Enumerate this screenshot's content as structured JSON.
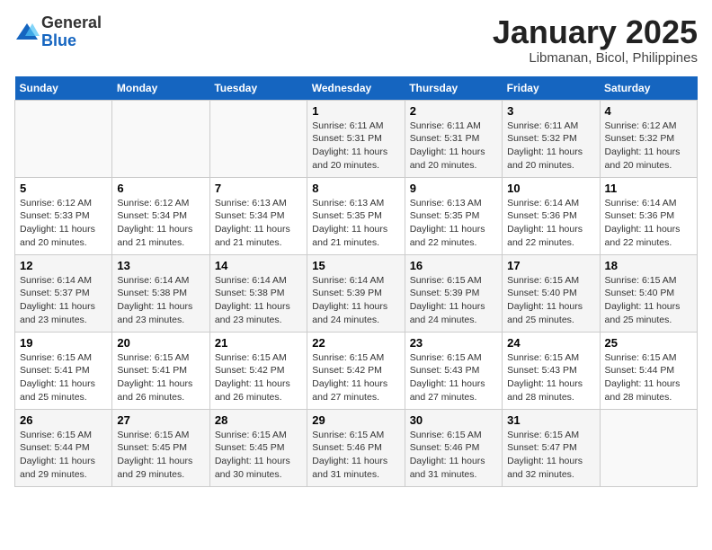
{
  "logo": {
    "general": "General",
    "blue": "Blue"
  },
  "header": {
    "month": "January 2025",
    "location": "Libmanan, Bicol, Philippines"
  },
  "days_of_week": [
    "Sunday",
    "Monday",
    "Tuesday",
    "Wednesday",
    "Thursday",
    "Friday",
    "Saturday"
  ],
  "weeks": [
    [
      {
        "day": "",
        "info": ""
      },
      {
        "day": "",
        "info": ""
      },
      {
        "day": "",
        "info": ""
      },
      {
        "day": "1",
        "info": "Sunrise: 6:11 AM\nSunset: 5:31 PM\nDaylight: 11 hours and 20 minutes."
      },
      {
        "day": "2",
        "info": "Sunrise: 6:11 AM\nSunset: 5:31 PM\nDaylight: 11 hours and 20 minutes."
      },
      {
        "day": "3",
        "info": "Sunrise: 6:11 AM\nSunset: 5:32 PM\nDaylight: 11 hours and 20 minutes."
      },
      {
        "day": "4",
        "info": "Sunrise: 6:12 AM\nSunset: 5:32 PM\nDaylight: 11 hours and 20 minutes."
      }
    ],
    [
      {
        "day": "5",
        "info": "Sunrise: 6:12 AM\nSunset: 5:33 PM\nDaylight: 11 hours and 20 minutes."
      },
      {
        "day": "6",
        "info": "Sunrise: 6:12 AM\nSunset: 5:34 PM\nDaylight: 11 hours and 21 minutes."
      },
      {
        "day": "7",
        "info": "Sunrise: 6:13 AM\nSunset: 5:34 PM\nDaylight: 11 hours and 21 minutes."
      },
      {
        "day": "8",
        "info": "Sunrise: 6:13 AM\nSunset: 5:35 PM\nDaylight: 11 hours and 21 minutes."
      },
      {
        "day": "9",
        "info": "Sunrise: 6:13 AM\nSunset: 5:35 PM\nDaylight: 11 hours and 22 minutes."
      },
      {
        "day": "10",
        "info": "Sunrise: 6:14 AM\nSunset: 5:36 PM\nDaylight: 11 hours and 22 minutes."
      },
      {
        "day": "11",
        "info": "Sunrise: 6:14 AM\nSunset: 5:36 PM\nDaylight: 11 hours and 22 minutes."
      }
    ],
    [
      {
        "day": "12",
        "info": "Sunrise: 6:14 AM\nSunset: 5:37 PM\nDaylight: 11 hours and 23 minutes."
      },
      {
        "day": "13",
        "info": "Sunrise: 6:14 AM\nSunset: 5:38 PM\nDaylight: 11 hours and 23 minutes."
      },
      {
        "day": "14",
        "info": "Sunrise: 6:14 AM\nSunset: 5:38 PM\nDaylight: 11 hours and 23 minutes."
      },
      {
        "day": "15",
        "info": "Sunrise: 6:14 AM\nSunset: 5:39 PM\nDaylight: 11 hours and 24 minutes."
      },
      {
        "day": "16",
        "info": "Sunrise: 6:15 AM\nSunset: 5:39 PM\nDaylight: 11 hours and 24 minutes."
      },
      {
        "day": "17",
        "info": "Sunrise: 6:15 AM\nSunset: 5:40 PM\nDaylight: 11 hours and 25 minutes."
      },
      {
        "day": "18",
        "info": "Sunrise: 6:15 AM\nSunset: 5:40 PM\nDaylight: 11 hours and 25 minutes."
      }
    ],
    [
      {
        "day": "19",
        "info": "Sunrise: 6:15 AM\nSunset: 5:41 PM\nDaylight: 11 hours and 25 minutes."
      },
      {
        "day": "20",
        "info": "Sunrise: 6:15 AM\nSunset: 5:41 PM\nDaylight: 11 hours and 26 minutes."
      },
      {
        "day": "21",
        "info": "Sunrise: 6:15 AM\nSunset: 5:42 PM\nDaylight: 11 hours and 26 minutes."
      },
      {
        "day": "22",
        "info": "Sunrise: 6:15 AM\nSunset: 5:42 PM\nDaylight: 11 hours and 27 minutes."
      },
      {
        "day": "23",
        "info": "Sunrise: 6:15 AM\nSunset: 5:43 PM\nDaylight: 11 hours and 27 minutes."
      },
      {
        "day": "24",
        "info": "Sunrise: 6:15 AM\nSunset: 5:43 PM\nDaylight: 11 hours and 28 minutes."
      },
      {
        "day": "25",
        "info": "Sunrise: 6:15 AM\nSunset: 5:44 PM\nDaylight: 11 hours and 28 minutes."
      }
    ],
    [
      {
        "day": "26",
        "info": "Sunrise: 6:15 AM\nSunset: 5:44 PM\nDaylight: 11 hours and 29 minutes."
      },
      {
        "day": "27",
        "info": "Sunrise: 6:15 AM\nSunset: 5:45 PM\nDaylight: 11 hours and 29 minutes."
      },
      {
        "day": "28",
        "info": "Sunrise: 6:15 AM\nSunset: 5:45 PM\nDaylight: 11 hours and 30 minutes."
      },
      {
        "day": "29",
        "info": "Sunrise: 6:15 AM\nSunset: 5:46 PM\nDaylight: 11 hours and 31 minutes."
      },
      {
        "day": "30",
        "info": "Sunrise: 6:15 AM\nSunset: 5:46 PM\nDaylight: 11 hours and 31 minutes."
      },
      {
        "day": "31",
        "info": "Sunrise: 6:15 AM\nSunset: 5:47 PM\nDaylight: 11 hours and 32 minutes."
      },
      {
        "day": "",
        "info": ""
      }
    ]
  ]
}
